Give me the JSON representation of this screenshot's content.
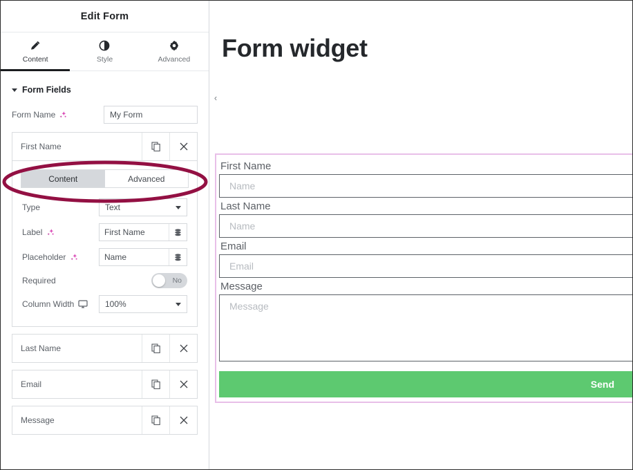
{
  "editor": {
    "header": {
      "title": "Edit Form"
    },
    "tabs": [
      {
        "label": "Content",
        "icon": "pencil-icon",
        "active": true
      },
      {
        "label": "Style",
        "icon": "contrast-icon",
        "active": false
      },
      {
        "label": "Advanced",
        "icon": "gear-icon",
        "active": false
      }
    ],
    "section": {
      "title": "Form Fields"
    },
    "form_name": {
      "label": "Form Name",
      "ai_icon": "ai-sparkle-icon",
      "value": "My Form",
      "placeholder": "My Form"
    },
    "expanded_field": {
      "name": "First Name",
      "duplicate_icon": "duplicate-icon",
      "remove_icon": "close-icon",
      "subtabs": [
        {
          "label": "Content",
          "active": true
        },
        {
          "label": "Advanced",
          "active": false
        }
      ],
      "rows": {
        "type": {
          "label": "Type",
          "value": "Text"
        },
        "label": {
          "label": "Label",
          "ai_icon": "ai-sparkle-icon",
          "value": "First Name",
          "tag_icon": "dynamic-tag-icon"
        },
        "placeholder": {
          "label": "Placeholder",
          "ai_icon": "ai-sparkle-icon",
          "value": "Name",
          "tag_icon": "dynamic-tag-icon"
        },
        "required": {
          "label": "Required",
          "value": "No",
          "state": "off"
        },
        "column_width": {
          "label": "Column Width",
          "device_icon": "monitor-icon",
          "value": "100%"
        }
      }
    },
    "fields": [
      {
        "name": "Last Name",
        "duplicate_icon": "duplicate-icon",
        "remove_icon": "close-icon"
      },
      {
        "name": "Email",
        "duplicate_icon": "duplicate-icon",
        "remove_icon": "close-icon"
      },
      {
        "name": "Message",
        "duplicate_icon": "duplicate-icon",
        "remove_icon": "close-icon"
      }
    ]
  },
  "preview": {
    "page_title": "Form widget",
    "collapse_icon": "chevron-left-icon",
    "fields": [
      {
        "label": "First Name",
        "placeholder": "Name",
        "type": "text"
      },
      {
        "label": "Last Name",
        "placeholder": "Name",
        "type": "text"
      },
      {
        "label": "Email",
        "placeholder": "Email",
        "type": "text"
      },
      {
        "label": "Message",
        "placeholder": "Message",
        "type": "textarea"
      }
    ],
    "submit": {
      "label": "Send",
      "color": "#5dc970"
    }
  },
  "annotation": {
    "shape": "ellipse",
    "color": "#931043",
    "target": "First Name"
  }
}
